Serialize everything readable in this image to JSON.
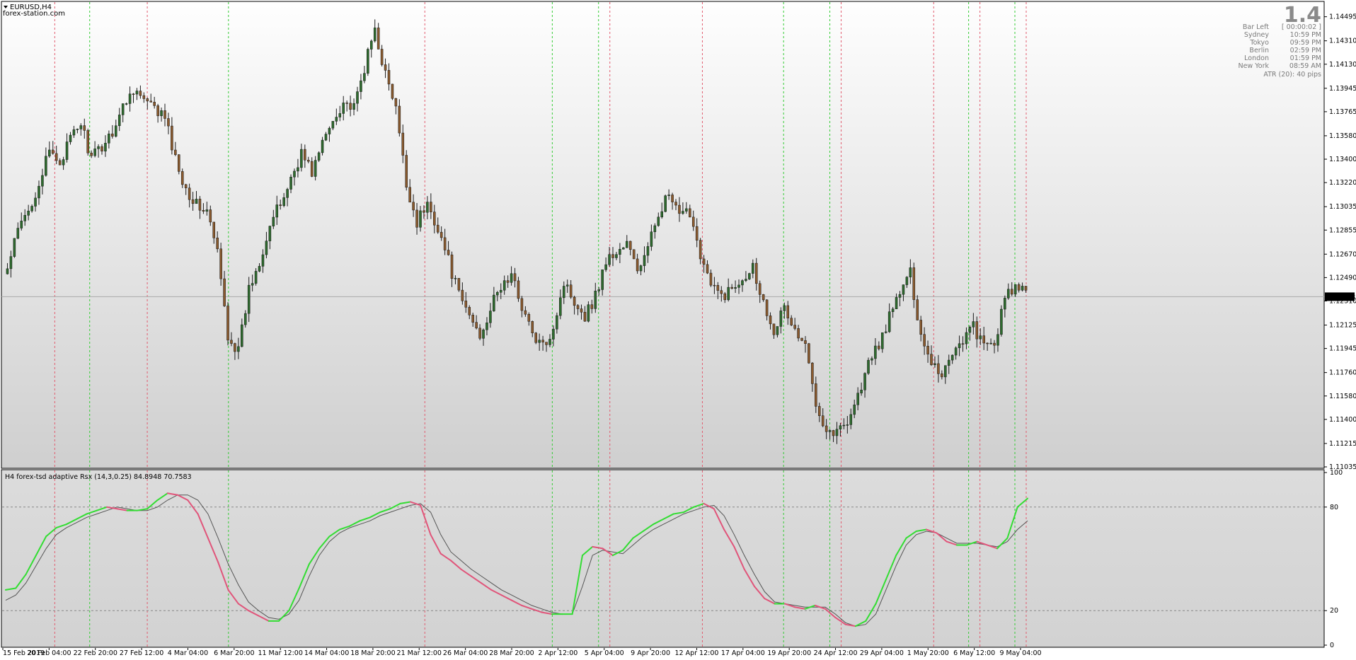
{
  "window": {
    "symbol_label": "EURUSD,H4",
    "source_label": "forex-station.com"
  },
  "info_panel": {
    "big_value": "1.4",
    "rows": [
      {
        "label": "Bar Left",
        "value": "[ 00:00:02 ]"
      },
      {
        "label": "Sydney",
        "value": "10:59 PM"
      },
      {
        "label": "Tokyo",
        "value": "09:59 PM"
      },
      {
        "label": "Berlin",
        "value": "02:59 PM"
      },
      {
        "label": "London",
        "value": "01:59 PM"
      },
      {
        "label": "New York",
        "value": "08:59 AM"
      }
    ],
    "atr": "ATR (20): 40 pips"
  },
  "indicator": {
    "label": "H4 forex-tsd adaptive Rsx (14,3,0.25) 84.8948 70.7583"
  },
  "colors": {
    "panel_top": "#fefefe",
    "panel_bottom": "#cfcfcf",
    "bull": "#2e6b2e",
    "bear": "#8a5a2e",
    "wick": "#1a1a1a",
    "rsx_up": "#33dd33",
    "rsx_down": "#e0557a",
    "signal": "#555555",
    "vline_green": "#33cc33",
    "vline_red": "#e25b6e",
    "level_line": "#888888",
    "price_tag_bg": "#000000"
  },
  "chart_data": [
    {
      "type": "candlestick",
      "title": "EURUSD,H4",
      "ylim": [
        1.11035,
        1.1458
      ],
      "y_ticks": [
        "1.14495",
        "1.14310",
        "1.14130",
        "1.13945",
        "1.13765",
        "1.13580",
        "1.13400",
        "1.13220",
        "1.13035",
        "1.12855",
        "1.12670",
        "1.12490",
        "1.12310",
        "1.12125",
        "1.11945",
        "1.11760",
        "1.11580",
        "1.11400",
        "1.11215",
        "1.11035"
      ],
      "current_price": "1.12343",
      "x_ticks": [
        "15 Feb 2019",
        "20 Feb 04:00",
        "22 Feb 20:00",
        "27 Feb 12:00",
        "4 Mar 04:00",
        "6 Mar 20:00",
        "11 Mar 12:00",
        "14 Mar 04:00",
        "18 Mar 20:00",
        "21 Mar 12:00",
        "26 Mar 04:00",
        "28 Mar 20:00",
        "2 Apr 12:00",
        "5 Apr 04:00",
        "9 Apr 20:00",
        "12 Apr 12:00",
        "17 Apr 04:00",
        "19 Apr 20:00",
        "24 Apr 12:00",
        "29 Apr 04:00",
        "1 May 20:00",
        "6 May 12:00",
        "9 May 04:00"
      ],
      "close_path": [
        1.1255,
        1.1285,
        1.13,
        1.1322,
        1.1345,
        1.1338,
        1.1355,
        1.1368,
        1.134,
        1.135,
        1.1362,
        1.138,
        1.1395,
        1.1385,
        1.1378,
        1.1372,
        1.134,
        1.1318,
        1.1305,
        1.13,
        1.1268,
        1.1205,
        1.1192,
        1.124,
        1.1262,
        1.129,
        1.1305,
        1.1325,
        1.1345,
        1.133,
        1.1352,
        1.137,
        1.1385,
        1.1378,
        1.141,
        1.144,
        1.1405,
        1.1378,
        1.132,
        1.1292,
        1.1305,
        1.1288,
        1.1262,
        1.1235,
        1.122,
        1.1205,
        1.1225,
        1.1242,
        1.125,
        1.1228,
        1.1205,
        1.1195,
        1.1212,
        1.1245,
        1.1232,
        1.122,
        1.1235,
        1.1262,
        1.1268,
        1.1275,
        1.1255,
        1.127,
        1.13,
        1.1312,
        1.1295,
        1.13,
        1.1268,
        1.1242,
        1.1235,
        1.124,
        1.125,
        1.1258,
        1.123,
        1.121,
        1.1225,
        1.1208,
        1.1195,
        1.1155,
        1.1132,
        1.113,
        1.114,
        1.1158,
        1.1182,
        1.1198,
        1.1218,
        1.1238,
        1.1252,
        1.1205,
        1.1185,
        1.1175,
        1.1192,
        1.1202,
        1.1212,
        1.1195,
        1.1198,
        1.1232,
        1.1242,
        1.1236
      ],
      "vlines_green": [
        "22 Feb 20:00",
        "6 Mar 20:00",
        "2 Apr 12:00",
        "5 Apr 04:00",
        "19 Apr 20:00",
        "24 Apr 12:00",
        "6 May 12:00",
        "9 May 04:00"
      ],
      "vlines_red": [
        "20 Feb 04:00",
        "27 Feb 12:00",
        "21 Mar 12:00",
        "5 Apr 04:00",
        "12 Apr 12:00",
        "24 Apr 12:00",
        "1 May 20:00",
        "6 May 12:00",
        "9 May 04:00"
      ]
    },
    {
      "type": "line",
      "title": "H4 forex-tsd adaptive Rsx (14,3,0.25) 84.8948 70.7583",
      "ylim": [
        0,
        100
      ],
      "y_ticks": [
        "100",
        "80",
        "20",
        "0"
      ],
      "levels": [
        80,
        20
      ],
      "series": [
        {
          "values": [
            32,
            33,
            41,
            52,
            63,
            68,
            70,
            73,
            76,
            78,
            80,
            79,
            78,
            78,
            79,
            84,
            88,
            87,
            84,
            76,
            62,
            48,
            32,
            24,
            20,
            17,
            14,
            14,
            20,
            33,
            47,
            56,
            63,
            67,
            69,
            72,
            74,
            77,
            79,
            82,
            83,
            81,
            64,
            53,
            49,
            44,
            40,
            36,
            32,
            29,
            26,
            23,
            21,
            19,
            18,
            18,
            18,
            52,
            57,
            56,
            52,
            55,
            62,
            66,
            70,
            73,
            76,
            77,
            80,
            82,
            79,
            67,
            57,
            44,
            34,
            27,
            24,
            24,
            22,
            21,
            23,
            21,
            16,
            12,
            11,
            14,
            24,
            38,
            52,
            62,
            66,
            67,
            65,
            60,
            58,
            58,
            60,
            58,
            56,
            62,
            80,
            85
          ]
        },
        {
          "values": [
            26,
            29,
            36,
            46,
            56,
            64,
            68,
            71,
            74,
            76,
            78,
            80,
            79,
            78,
            78,
            80,
            84,
            87,
            87,
            84,
            76,
            62,
            47,
            35,
            25,
            20,
            16,
            15,
            18,
            26,
            40,
            52,
            60,
            65,
            68,
            70,
            72,
            75,
            77,
            79,
            81,
            82,
            77,
            64,
            54,
            49,
            44,
            40,
            36,
            32,
            29,
            26,
            23,
            21,
            19,
            18,
            18,
            34,
            52,
            55,
            54,
            53,
            58,
            63,
            67,
            70,
            73,
            76,
            78,
            80,
            81,
            75,
            64,
            52,
            41,
            31,
            25,
            24,
            23,
            22,
            22,
            22,
            18,
            13,
            11,
            12,
            18,
            32,
            46,
            58,
            64,
            66,
            65,
            62,
            59,
            59,
            59,
            58,
            57,
            60,
            67,
            72
          ]
        }
      ]
    }
  ]
}
